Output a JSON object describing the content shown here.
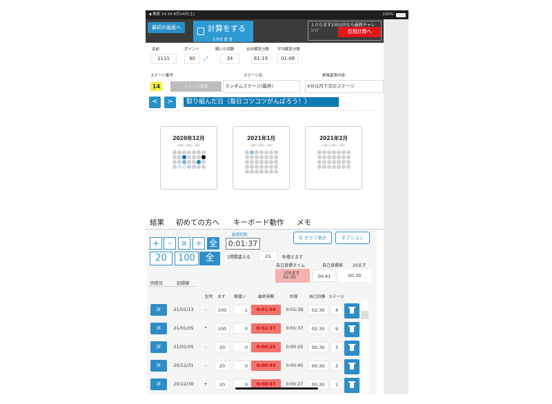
{
  "status_bar": {
    "left": "◀ 検索 14:34 8月14日(土)",
    "right": "100%"
  },
  "header": {
    "first_screen": "最初の画面へ",
    "calc_main": "計算をする",
    "calc_sub": "100ます",
    "challenge_text": "１００ます2分以内なら最終チャレンジ",
    "hyakuwari": "百割計算へ"
  },
  "stats": {
    "labels": {
      "name": "名前",
      "points": "ポイント",
      "solved": "解いた回数",
      "total": "合計解答分数",
      "avg": "平均解答分数"
    },
    "name": "1111",
    "points": "90",
    "solved": "34",
    "total": "61:19",
    "avg": "01:48"
  },
  "stage": {
    "labels": {
      "number": "ステージ番号",
      "name": "ステージ名",
      "criteria": "昇格基準内容"
    },
    "number": "14",
    "change_button": "ステージ変更",
    "name": "ランダムステージ(最終)",
    "criteria": "4分以内で次のステージ"
  },
  "calendar": {
    "prev": "<",
    "next": ">",
    "banner": "取り組んだ日（毎日コツコツがんばろう！）",
    "weekdays": "日曜日 月曜日 火曜日",
    "months": [
      "2020年12月",
      "2021年1月",
      "2021年2月"
    ]
  },
  "tabs": [
    "結果",
    "初めての方へ",
    "キーボード動作",
    "メモ"
  ],
  "controls": {
    "ops": [
      "+",
      "-",
      "×",
      "÷",
      "全"
    ],
    "sizes": [
      "20",
      "100",
      "全"
    ],
    "best_label": "最速記録",
    "best_time": "0:01:37",
    "graph": "グラフ表示",
    "option": "オプション",
    "penalty_pre": "1問間違える",
    "penalty_val": "15",
    "penalty_post": "秒増えます",
    "target_time_label": "自己目標タイム",
    "target_diff_label": "自己目標差",
    "size20_label": "20ます",
    "size100_label": "100ます",
    "target_100": "02:30",
    "target_diff": "00:41",
    "target_20": "00:30"
  },
  "sort": {
    "by_day": "回答日",
    "by_record": "記録順"
  },
  "table": {
    "headers": [
      "記号",
      "ます",
      "間違い",
      "最終時間",
      "計算",
      "自己目標",
      "ステージ"
    ],
    "detail_label": "詳",
    "rows": [
      {
        "date": "21/01/13",
        "op": "-",
        "size": "100",
        "mistakes": "1",
        "final": "0:01:54",
        "calc": "0:01:39",
        "target": "02:30",
        "stage": "4"
      },
      {
        "date": "21/01/05",
        "op": "*",
        "size": "100",
        "mistakes": "0",
        "final": "0:01:37",
        "calc": "0:01:37",
        "target": "02:30",
        "stage": "9"
      },
      {
        "date": "21/01/05",
        "op": "-",
        "size": "20",
        "mistakes": "0",
        "final": "0:00:25",
        "calc": "0:00:25",
        "target": "00:30",
        "stage": "3"
      },
      {
        "date": "20/12/31",
        "op": "-",
        "size": "20",
        "mistakes": "0",
        "final": "0:00:45",
        "calc": "0:00:45",
        "target": "00:30",
        "stage": "3"
      },
      {
        "date": "20/12/30",
        "op": "+",
        "size": "20",
        "mistakes": "0",
        "final": "0:00:27",
        "calc": "0:00:27",
        "target": "00:30",
        "stage": "1"
      }
    ]
  }
}
